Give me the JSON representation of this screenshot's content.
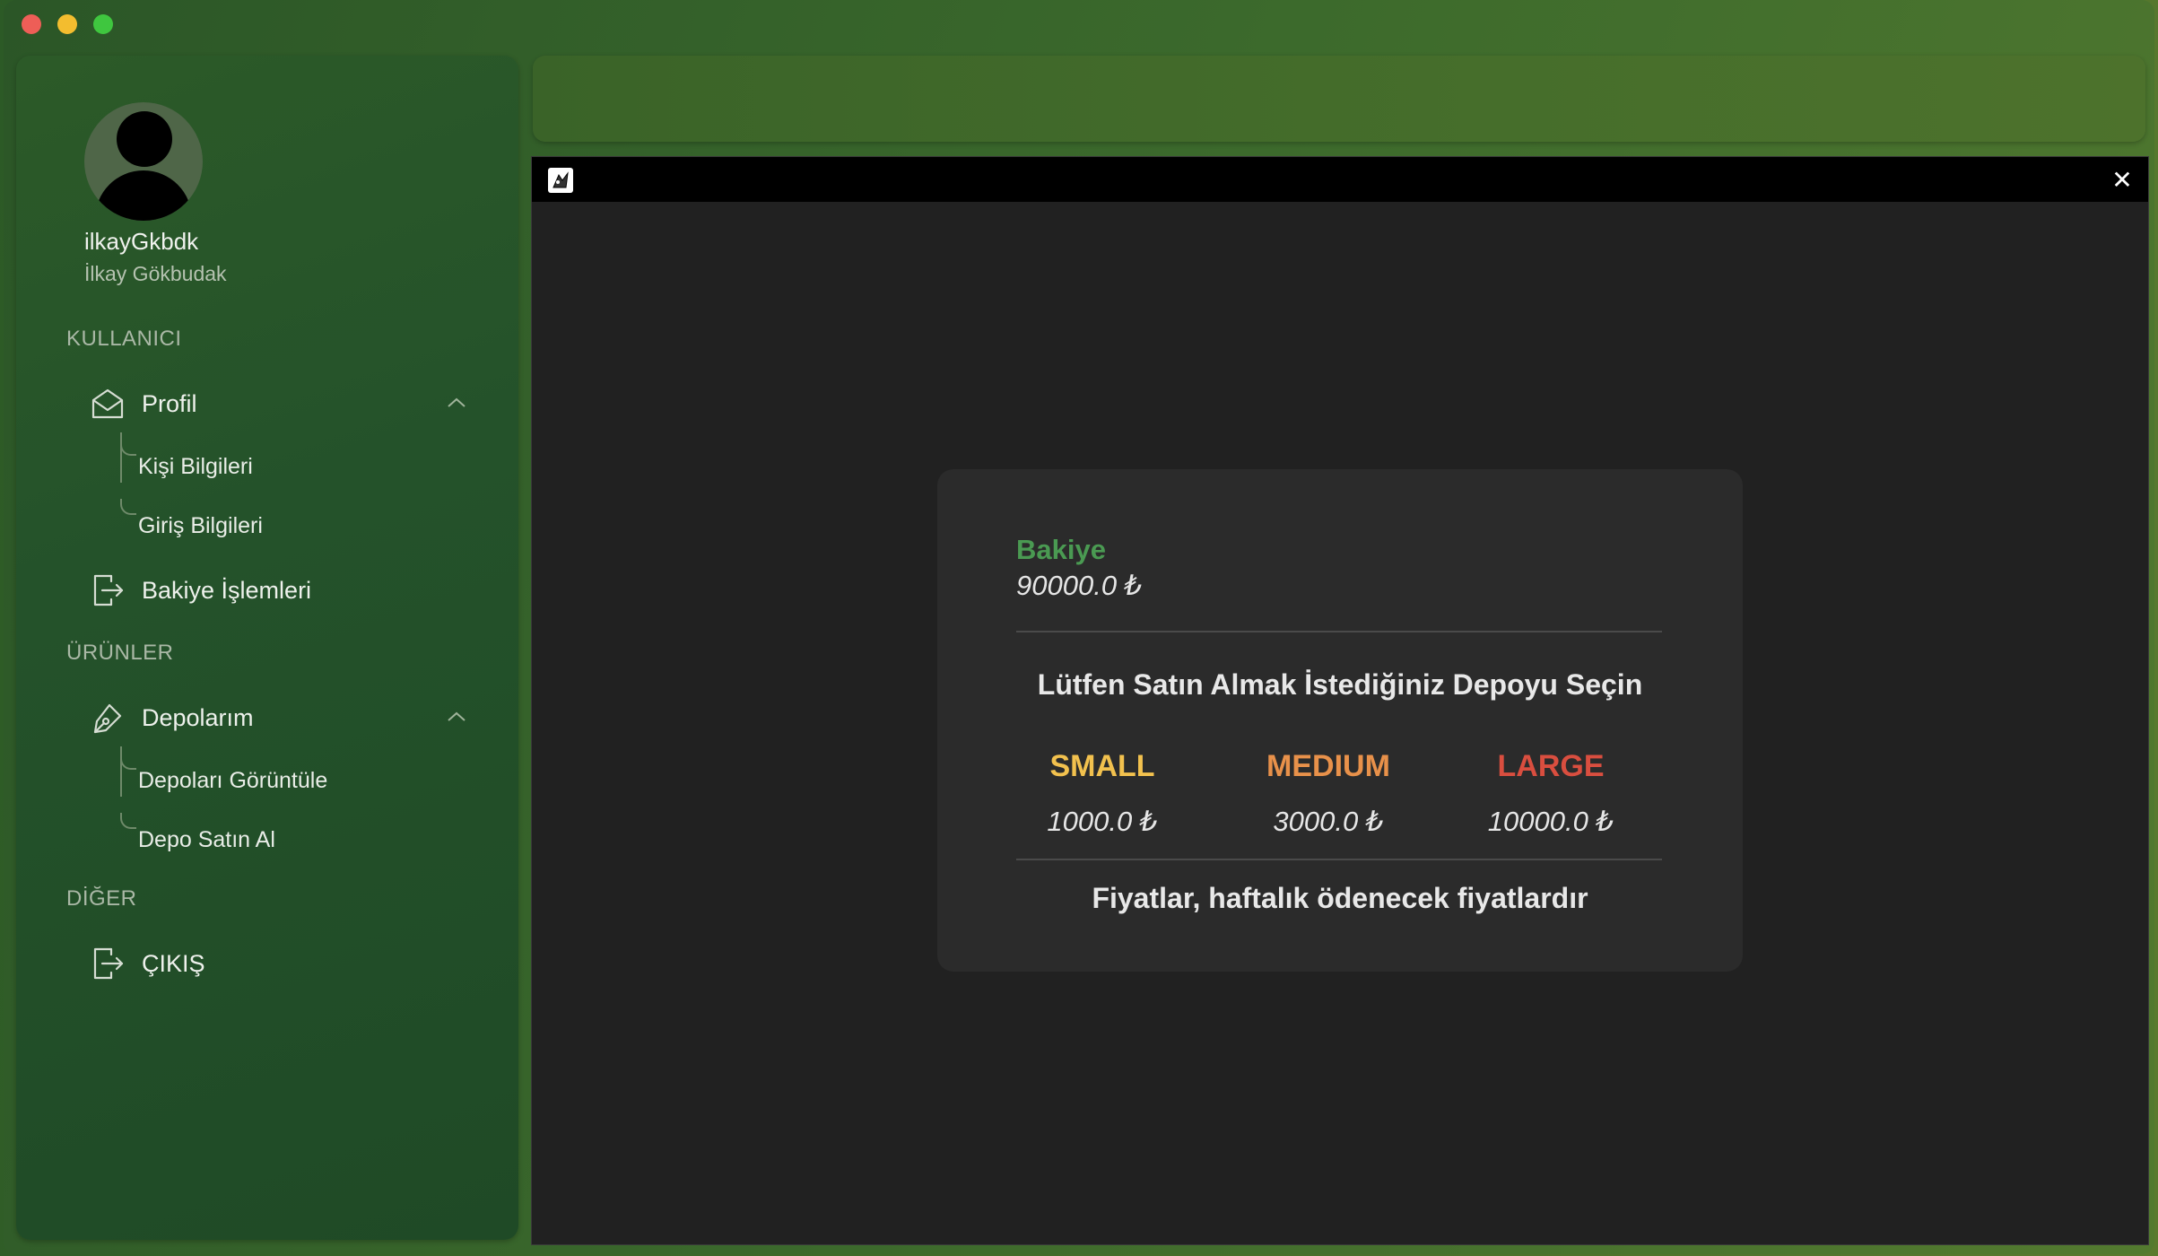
{
  "colors": {
    "accent_green": "#4a9a52",
    "small": "#f2c14e",
    "medium": "#e8914a",
    "large": "#d94e3f"
  },
  "user": {
    "username": "ilkayGkbdk",
    "full_name": "İlkay Gökbudak"
  },
  "sidebar": {
    "sections": {
      "user": "KULLANICI",
      "products": "ÜRÜNLER",
      "other": "DİĞER"
    },
    "profile": {
      "label": "Profil",
      "icon": "mail-icon",
      "children": [
        "Kişi Bilgileri",
        "Giriş Bilgileri"
      ]
    },
    "balance_ops": {
      "label": "Bakiye İşlemleri",
      "icon": "logout-icon"
    },
    "warehouses": {
      "label": "Depolarım",
      "icon": "pen-icon",
      "children": [
        "Depoları Görüntüle",
        "Depo Satın Al"
      ]
    },
    "exit": {
      "label": "ÇIKIŞ",
      "icon": "logout-icon"
    }
  },
  "dialog": {
    "close_label": "✕",
    "balance_label": "Bakiye",
    "balance_value": "90000.0 ₺",
    "prompt": "Lütfen Satın Almak İstediğiniz Depoyu Seçin",
    "plans": [
      {
        "name": "SMALL",
        "price": "1000.0 ₺"
      },
      {
        "name": "MEDIUM",
        "price": "3000.0 ₺"
      },
      {
        "name": "LARGE",
        "price": "10000.0 ₺"
      }
    ],
    "note": "Fiyatlar, haftalık ödenecek fiyatlardır"
  }
}
